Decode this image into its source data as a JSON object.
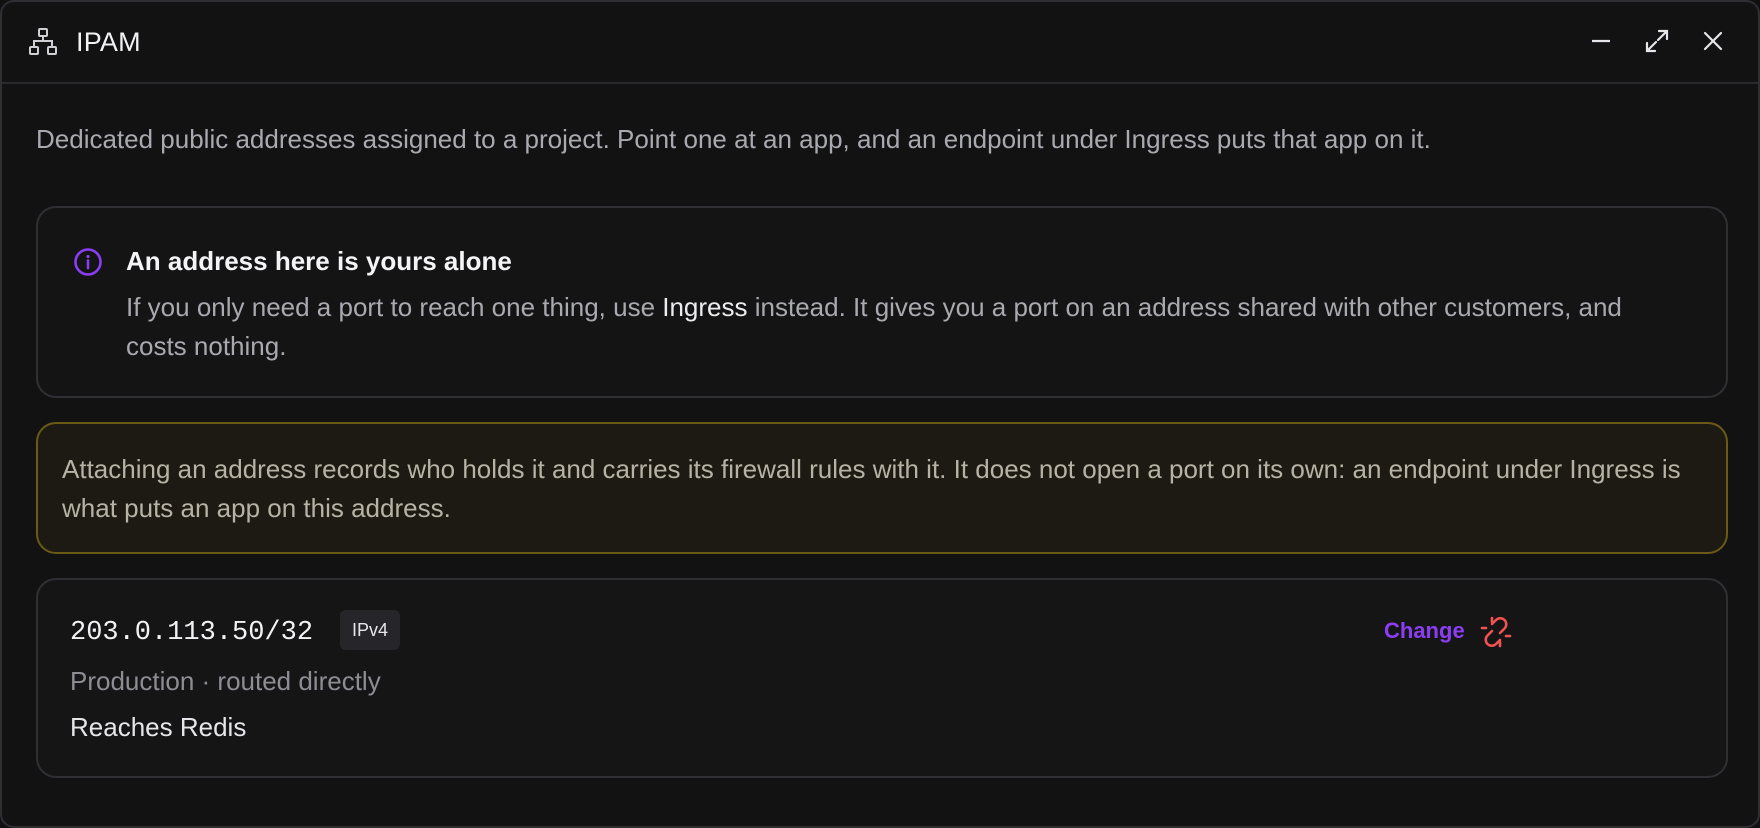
{
  "window": {
    "title": "IPAM",
    "title_icon": "sitemap-icon",
    "controls": [
      "minimize-icon",
      "maximize-icon",
      "close-icon"
    ]
  },
  "description": "Dedicated public addresses assigned to a project. Point one at an app, and an endpoint under Ingress puts that app on it.",
  "info": {
    "icon": "info-icon",
    "title": "An address here is yours alone",
    "body_before": "If you only need a port to reach one thing, use ",
    "body_link": "Ingress",
    "body_after": " instead. It gives you a port on an address shared with other customers, and costs nothing."
  },
  "warning": {
    "body": "Attaching an address records who holds it and carries its firewall rules with it. It does not open a port on its own: an endpoint under Ingress is what puts an app on this address."
  },
  "address": {
    "value": "203.0.113.50/32",
    "badge": "IPv4",
    "meta": "Production · routed directly",
    "target": "Reaches Redis",
    "change_label": "Change",
    "detach_icon": "unlink-icon"
  },
  "colors": {
    "accent": "#8b3df2",
    "danger": "#f0524f",
    "warning_border": "#6b5a16"
  }
}
